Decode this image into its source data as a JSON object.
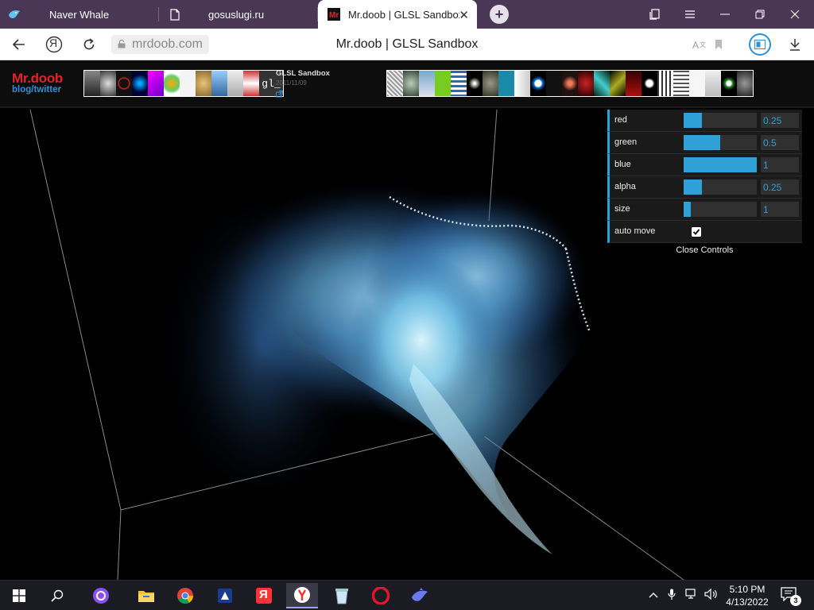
{
  "browser": {
    "tabs": [
      {
        "label": "Naver Whale",
        "active": false
      },
      {
        "label": "gosuslugi.ru",
        "active": false
      },
      {
        "label": "Mr.doob | GLSL Sandbox",
        "active": true
      }
    ],
    "domain": "mrdoob.com",
    "page_title": "Mr.doob | GLSL Sandbox",
    "yandex_button": "Я"
  },
  "site": {
    "logo_title": "Mr.doob",
    "logo_sub": "blog/twitter",
    "gl_thumb": "gl_",
    "project_title": "GLSL Sandbox",
    "project_date": "2011/11/09",
    "project_link_icon": "external-link-icon"
  },
  "controls": {
    "rows": [
      {
        "label": "red",
        "value": "0.25",
        "fraction": 0.25
      },
      {
        "label": "green",
        "value": "0.5",
        "fraction": 0.5
      },
      {
        "label": "blue",
        "value": "1",
        "fraction": 1.0
      },
      {
        "label": "alpha",
        "value": "0.25",
        "fraction": 0.25
      },
      {
        "label": "size",
        "value": "1",
        "fraction": 0.1
      }
    ],
    "auto_move_label": "auto move",
    "auto_move_checked": true,
    "close_label": "Close Controls"
  },
  "taskbar": {
    "time": "5:10 PM",
    "date": "4/13/2022",
    "notification_count": "3",
    "yandex_label": "Я"
  },
  "colors": {
    "accent": "#2fa1d6",
    "tabstrip": "#4a3655",
    "logo_red": "#e2232a",
    "logo_blue": "#2f8fd8"
  }
}
